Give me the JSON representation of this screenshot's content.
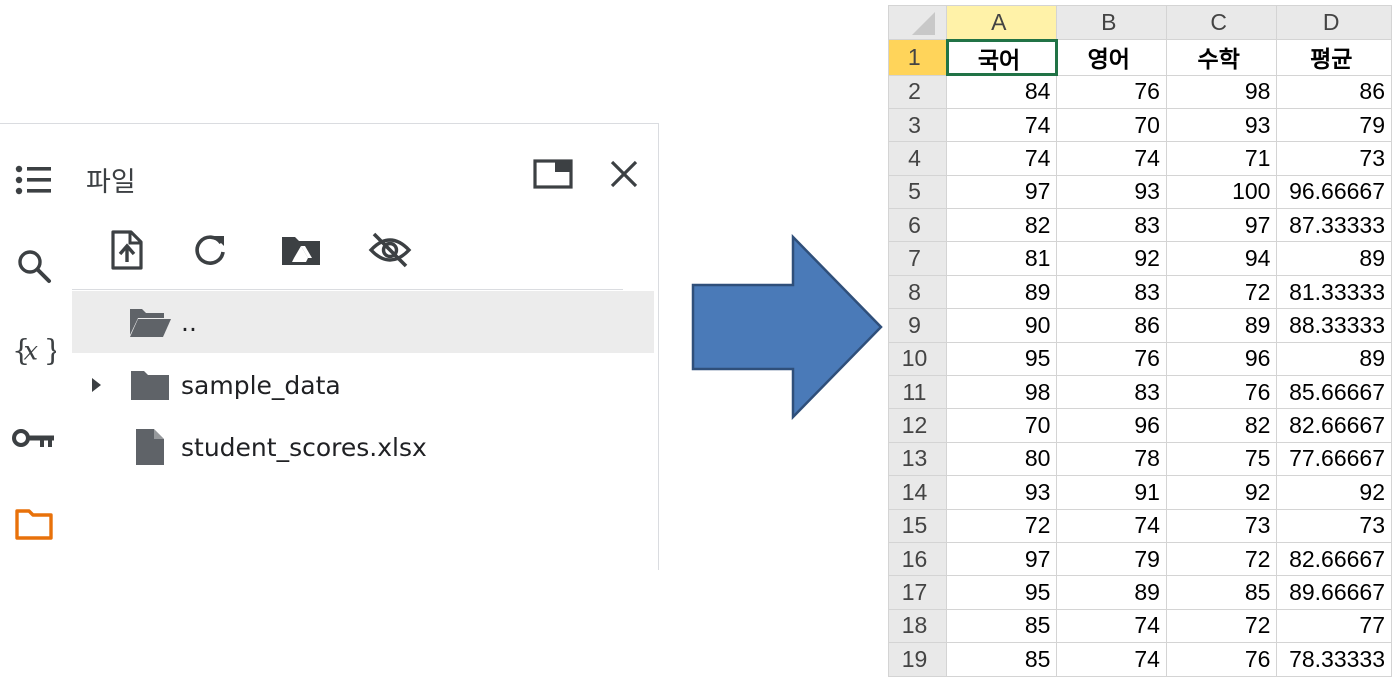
{
  "file_panel": {
    "title": "파일",
    "items": [
      {
        "name": "..",
        "icon": "folder-open-icon",
        "selected": true,
        "expandable": false
      },
      {
        "name": "sample_data",
        "icon": "folder-icon",
        "selected": false,
        "expandable": true
      },
      {
        "name": "student_scores.xlsx",
        "icon": "file-icon",
        "selected": false,
        "expandable": false
      }
    ],
    "toolbar": [
      "upload-icon",
      "refresh-icon",
      "drive-folder-icon",
      "hide-icon"
    ],
    "rail": [
      "table-of-contents-icon",
      "search-icon",
      "variables-icon",
      "key-icon",
      "folder-icon"
    ],
    "active_rail": "folder-icon",
    "accent_color": "#e8710a"
  },
  "arrow": {
    "color": "#4a7ab8",
    "stroke": "#2f4f7a"
  },
  "spreadsheet": {
    "columns": [
      "A",
      "B",
      "C",
      "D"
    ],
    "rows": [
      {
        "n": "1",
        "cells": [
          "국어",
          "영어",
          "수학",
          "평균"
        ]
      },
      {
        "n": "2",
        "cells": [
          "84",
          "76",
          "98",
          "86"
        ]
      },
      {
        "n": "3",
        "cells": [
          "74",
          "70",
          "93",
          "79"
        ]
      },
      {
        "n": "4",
        "cells": [
          "74",
          "74",
          "71",
          "73"
        ]
      },
      {
        "n": "5",
        "cells": [
          "97",
          "93",
          "100",
          "96.66667"
        ]
      },
      {
        "n": "6",
        "cells": [
          "82",
          "83",
          "97",
          "87.33333"
        ]
      },
      {
        "n": "7",
        "cells": [
          "81",
          "92",
          "94",
          "89"
        ]
      },
      {
        "n": "8",
        "cells": [
          "89",
          "83",
          "72",
          "81.33333"
        ]
      },
      {
        "n": "9",
        "cells": [
          "90",
          "86",
          "89",
          "88.33333"
        ]
      },
      {
        "n": "10",
        "cells": [
          "95",
          "76",
          "96",
          "89"
        ]
      },
      {
        "n": "11",
        "cells": [
          "98",
          "83",
          "76",
          "85.66667"
        ]
      },
      {
        "n": "12",
        "cells": [
          "70",
          "96",
          "82",
          "82.66667"
        ]
      },
      {
        "n": "13",
        "cells": [
          "80",
          "78",
          "75",
          "77.66667"
        ]
      },
      {
        "n": "14",
        "cells": [
          "93",
          "91",
          "92",
          "92"
        ]
      },
      {
        "n": "15",
        "cells": [
          "72",
          "74",
          "73",
          "73"
        ]
      },
      {
        "n": "16",
        "cells": [
          "97",
          "79",
          "72",
          "82.66667"
        ]
      },
      {
        "n": "17",
        "cells": [
          "95",
          "89",
          "85",
          "89.66667"
        ]
      },
      {
        "n": "18",
        "cells": [
          "85",
          "74",
          "72",
          "77"
        ]
      },
      {
        "n": "19",
        "cells": [
          "85",
          "74",
          "76",
          "78.33333"
        ]
      }
    ],
    "active_column": "A",
    "active_row": "1",
    "selection_color": "#217346"
  }
}
